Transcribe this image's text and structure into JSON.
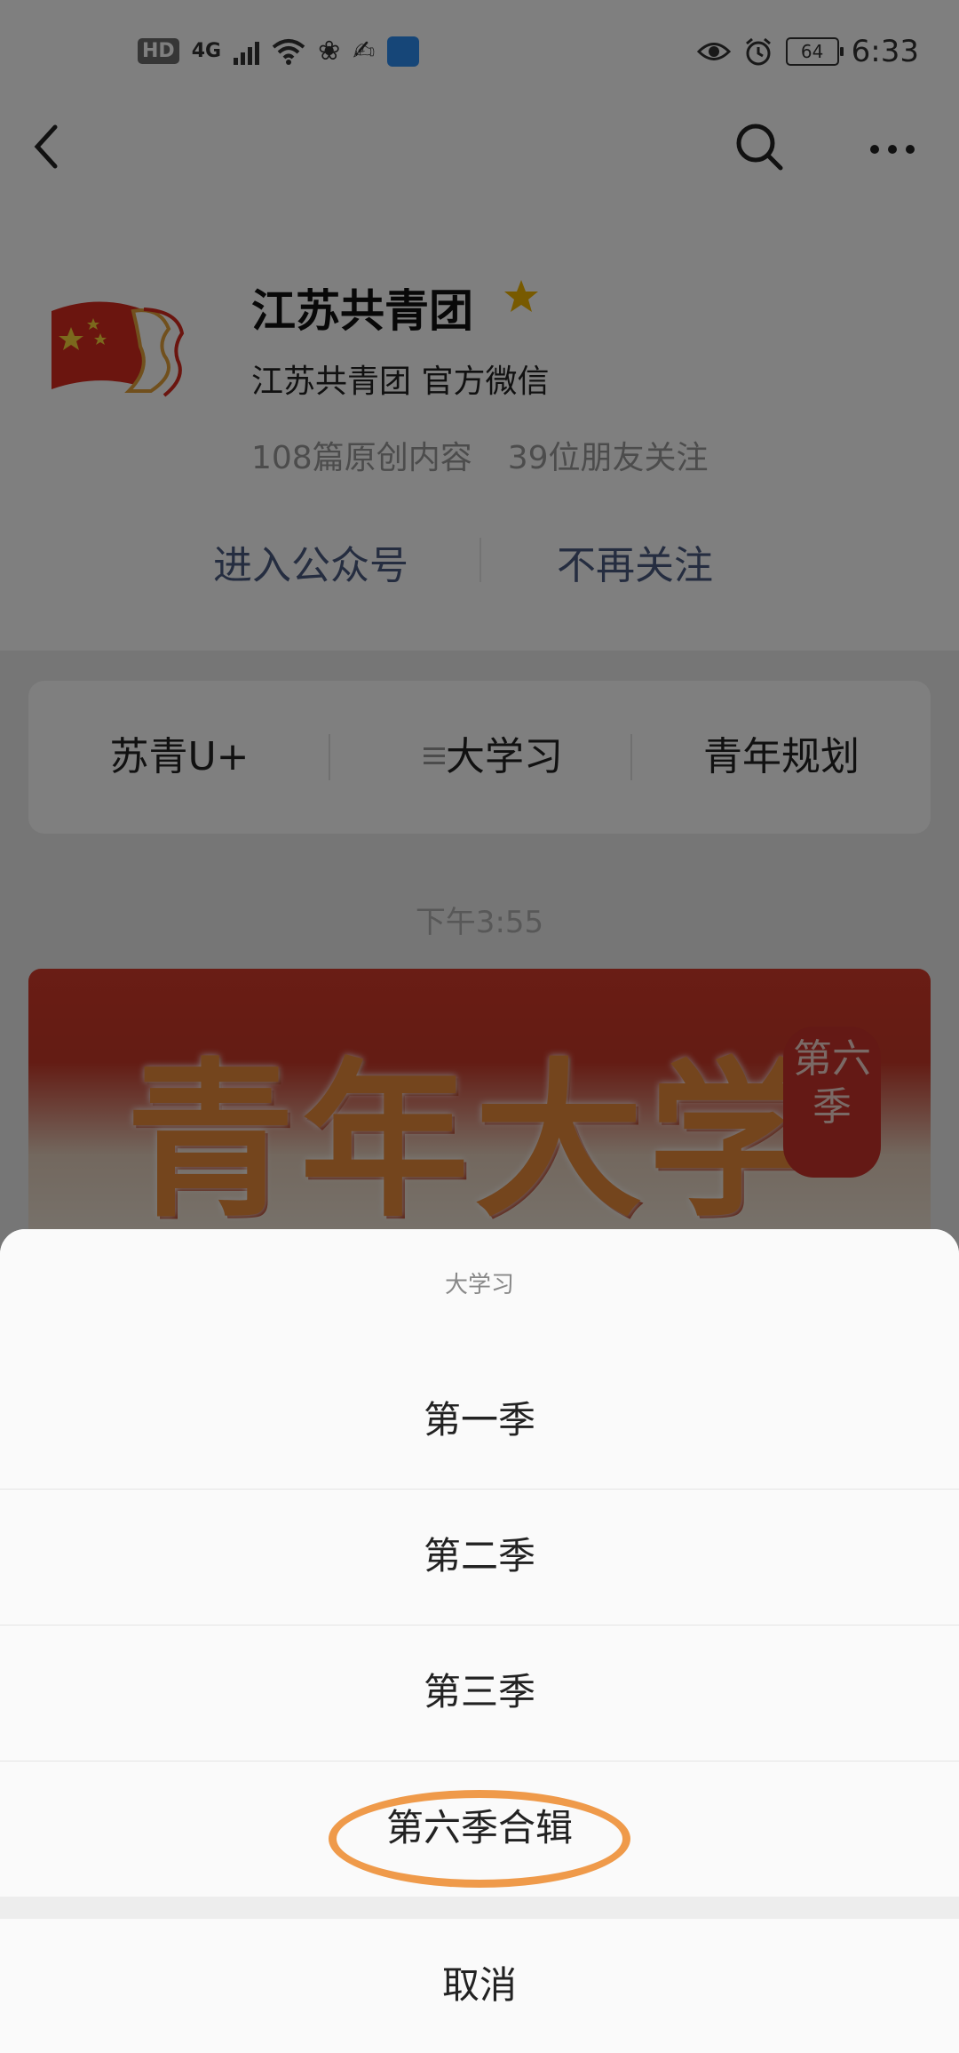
{
  "status_bar": {
    "hd_badge": "HD",
    "network": "4G",
    "battery": "64",
    "time": "6:33",
    "icons": [
      "signal-icon",
      "wifi-icon",
      "app-notification-icon",
      "eye-icon",
      "alarm-icon",
      "battery-icon"
    ]
  },
  "nav": {
    "icons": [
      "back-arrow-icon",
      "search-icon",
      "more-icon"
    ]
  },
  "profile": {
    "name": "江苏共青团",
    "description": "江苏共青团 官方微信",
    "original_count": "108篇原创内容",
    "friends_following": "39位朋友关注",
    "enter_button": "进入公众号",
    "unfollow_button": "不再关注",
    "colors": {
      "link": "#4b5a80",
      "star": "#f0b400"
    }
  },
  "menu": {
    "items": [
      "苏青U+",
      "大学习",
      "青年规划"
    ],
    "submenu_icon": "list-lines-icon"
  },
  "feed": {
    "timestamp": "下午3:55",
    "banner_title": "青年大学习",
    "banner_seal": "第六季"
  },
  "action_sheet": {
    "title": "大学习",
    "options": [
      "第一季",
      "第二季",
      "第三季",
      "第六季合辑"
    ],
    "cancel": "取消",
    "highlight_color": "#ef9a4a"
  }
}
